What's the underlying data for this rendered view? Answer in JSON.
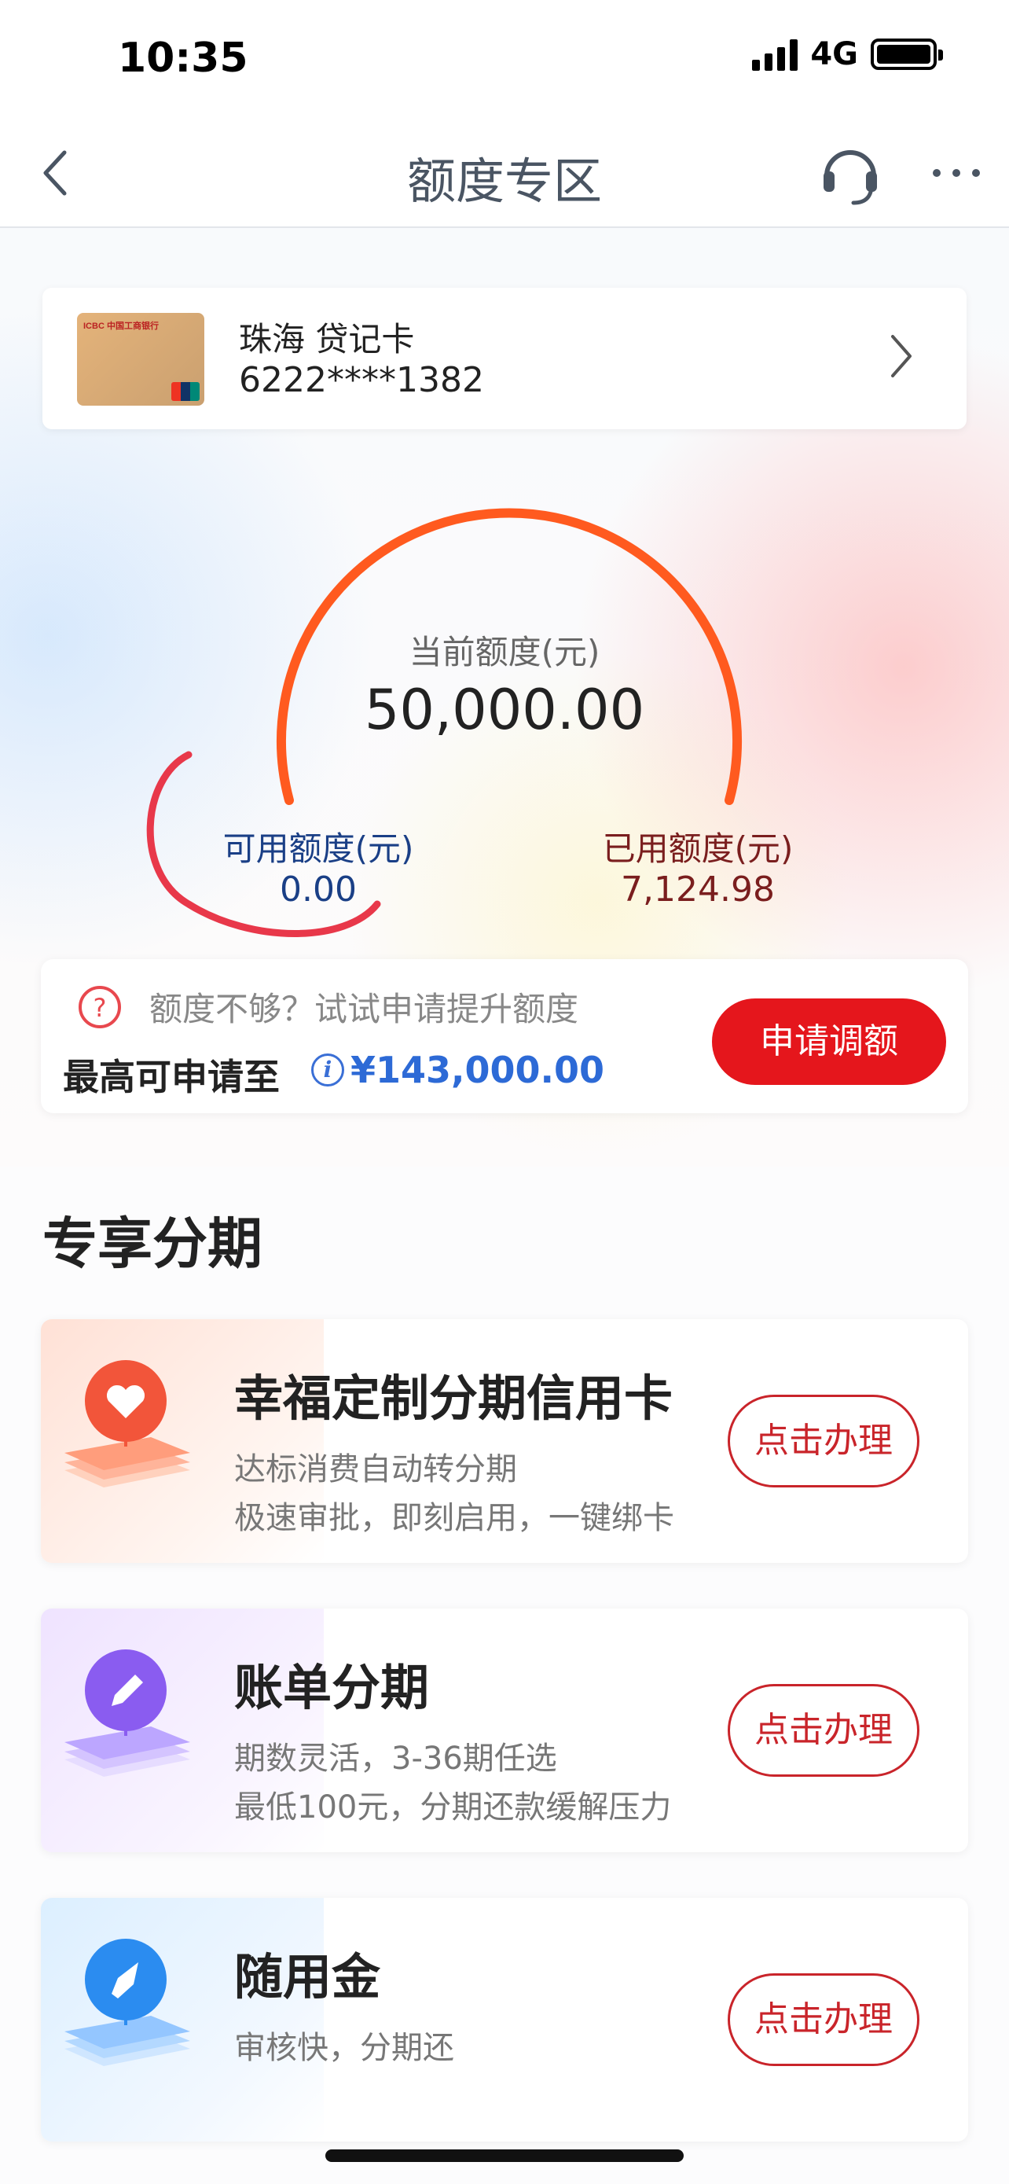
{
  "status": {
    "time": "10:35",
    "network": "4G"
  },
  "nav": {
    "title": "额度专区"
  },
  "card": {
    "name": "珠海 贷记卡",
    "number": "6222****1382",
    "logo_text": "ICBC 中国工商银行"
  },
  "gauge": {
    "current_label": "当前额度(元)",
    "current_value": "50,000.00",
    "available_label": "可用额度(元)",
    "available_value": "0.00",
    "used_label": "已用额度(元)",
    "used_value": "7,124.98",
    "used_fraction": 0.1425
  },
  "limit": {
    "tip": "额度不够？试试申请提升额度",
    "max_label": "最高可申请至",
    "max_value": "¥143,000.00",
    "apply_button": "申请调额"
  },
  "section": {
    "title": "专享分期",
    "items": [
      {
        "title": "幸福定制分期信用卡",
        "desc1": "达标消费自动转分期",
        "desc2": "极速审批，即刻启用，一键绑卡",
        "button": "点击办理",
        "icon": "heart-icon",
        "color": "#f2553a"
      },
      {
        "title": "账单分期",
        "desc1": "期数灵活，3-36期任选",
        "desc2": "最低100元，分期还款缓解压力",
        "button": "点击办理",
        "icon": "pencil-icon",
        "color": "#8a5cf0"
      },
      {
        "title": "随用金",
        "desc1": "审核快，分期还",
        "desc2": "",
        "button": "点击办理",
        "icon": "rocket-icon",
        "color": "#2b8cf0"
      }
    ]
  },
  "colors": {
    "accent_red": "#e5161c",
    "arc_orange": "#ff5a1f",
    "link_blue": "#2d6ad6"
  }
}
